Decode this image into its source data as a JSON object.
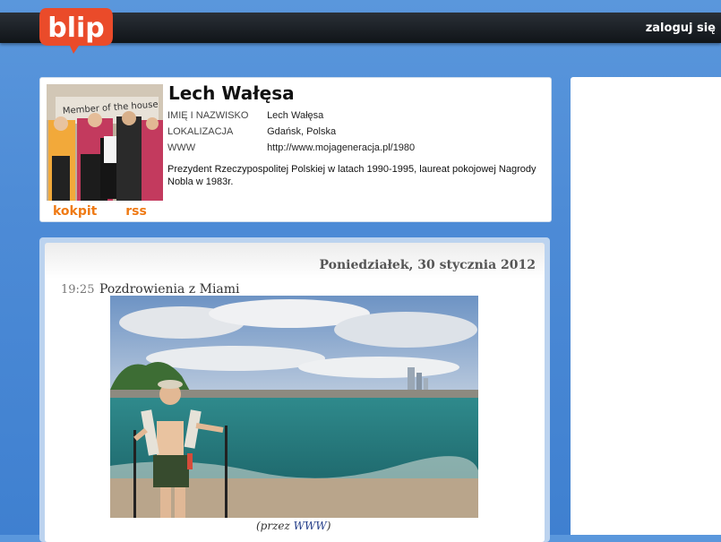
{
  "header": {
    "logo_text": "blip",
    "login_label": "zaloguj się"
  },
  "profile": {
    "name": "Lech Wałęsa",
    "fields": [
      {
        "label": "IMIĘ I NAZWISKO",
        "value": "Lech Wałęsa"
      },
      {
        "label": "LOKALIZACJA",
        "value": "Gdańsk, Polska"
      },
      {
        "label": "WWW",
        "value": "http://www.mojageneracja.pl/1980"
      }
    ],
    "bio": "Prezydent Rzeczypospolitej Polskiej w latach 1990-1995, laureat pokojowej Nagrody Nobla w 1983r.",
    "links": {
      "kokpit": "kokpit",
      "rss": "rss"
    },
    "photo_banner_text": "Member of the house"
  },
  "post": {
    "date": "Poniedziałek, 30 stycznia 2012",
    "time": "19:25",
    "title": "Pozdrowienia z Miami",
    "via_prefix": "(przez ",
    "via_link": "WWW",
    "via_suffix": ")"
  },
  "colors": {
    "accent": "#ef7a14",
    "logo_red": "#ea4b2a",
    "background_blue": "#4d8bd6",
    "link_blue": "#223c88"
  }
}
